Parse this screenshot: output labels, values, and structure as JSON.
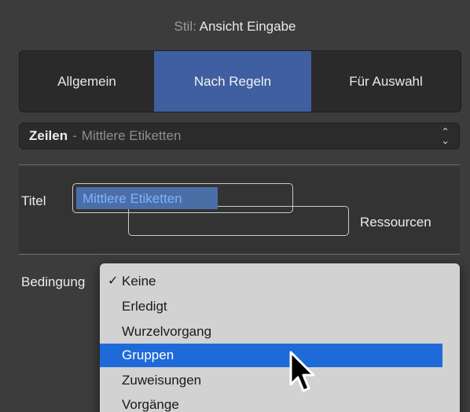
{
  "header": {
    "style_prefix": "Stil:",
    "style_value": "Ansicht Eingabe"
  },
  "tabs": [
    {
      "label": "Allgemein"
    },
    {
      "label": "Nach Regeln"
    },
    {
      "label": "Für Auswahl"
    }
  ],
  "rows_popup": {
    "main": "Zeilen",
    "separator": "-",
    "value": "Mittlere Etiketten"
  },
  "title_section": {
    "title_label": "Titel",
    "title_value": "Mittlere Etiketten",
    "resources_label": "Ressourcen"
  },
  "condition": {
    "label": "Bedingung"
  },
  "menu": {
    "check_glyph": "✓",
    "items": [
      {
        "label": "Keine"
      },
      {
        "label": "Erledigt"
      },
      {
        "label": "Wurzelvorgang"
      },
      {
        "label": "Gruppen"
      },
      {
        "label": "Zuweisungen"
      },
      {
        "label": "Vorgänge"
      }
    ],
    "checked_index": 0,
    "highlighted_index": 3,
    "highlight_color": "#1f6ad9"
  },
  "accent_color": "#3f5fa0"
}
